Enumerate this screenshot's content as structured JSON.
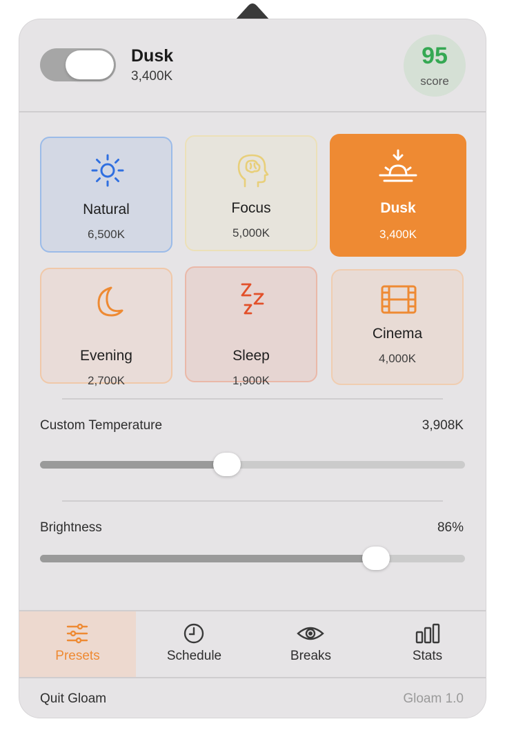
{
  "header": {
    "title": "Dusk",
    "subtitle": "3,400K",
    "enabled": true,
    "score_value": "95",
    "score_label": "score"
  },
  "presets": [
    {
      "name": "Natural",
      "temp": "6,500K",
      "icon": "sun-icon",
      "selected": false
    },
    {
      "name": "Focus",
      "temp": "5,000K",
      "icon": "brain-head-icon",
      "selected": false
    },
    {
      "name": "Dusk",
      "temp": "3,400K",
      "icon": "sunset-icon",
      "selected": true
    },
    {
      "name": "Evening",
      "temp": "2,700K",
      "icon": "moon-icon",
      "selected": false
    },
    {
      "name": "Sleep",
      "temp": "1,900K",
      "icon": "zzz-icon",
      "selected": false
    },
    {
      "name": "Cinema",
      "temp": "4,000K",
      "icon": "film-icon",
      "selected": false
    }
  ],
  "custom_temperature": {
    "label": "Custom Temperature",
    "value": "3,908K",
    "level": 0.44
  },
  "brightness": {
    "label": "Brightness",
    "value": "86%",
    "level": 0.79
  },
  "tabs": [
    {
      "label": "Presets",
      "icon": "sliders-icon",
      "active": true
    },
    {
      "label": "Schedule",
      "icon": "clock-icon",
      "active": false
    },
    {
      "label": "Breaks",
      "icon": "eye-icon",
      "active": false
    },
    {
      "label": "Stats",
      "icon": "bar-chart-icon",
      "active": false
    }
  ],
  "footer": {
    "quit_label": "Quit Gloam",
    "version": "Gloam 1.0"
  },
  "colors": {
    "accent": "#EE8A33",
    "score_green": "#35A853",
    "natural_blue": "#2F6FE0",
    "focus_yellow": "#E8CF7A",
    "sleep_red": "#E2502A"
  }
}
